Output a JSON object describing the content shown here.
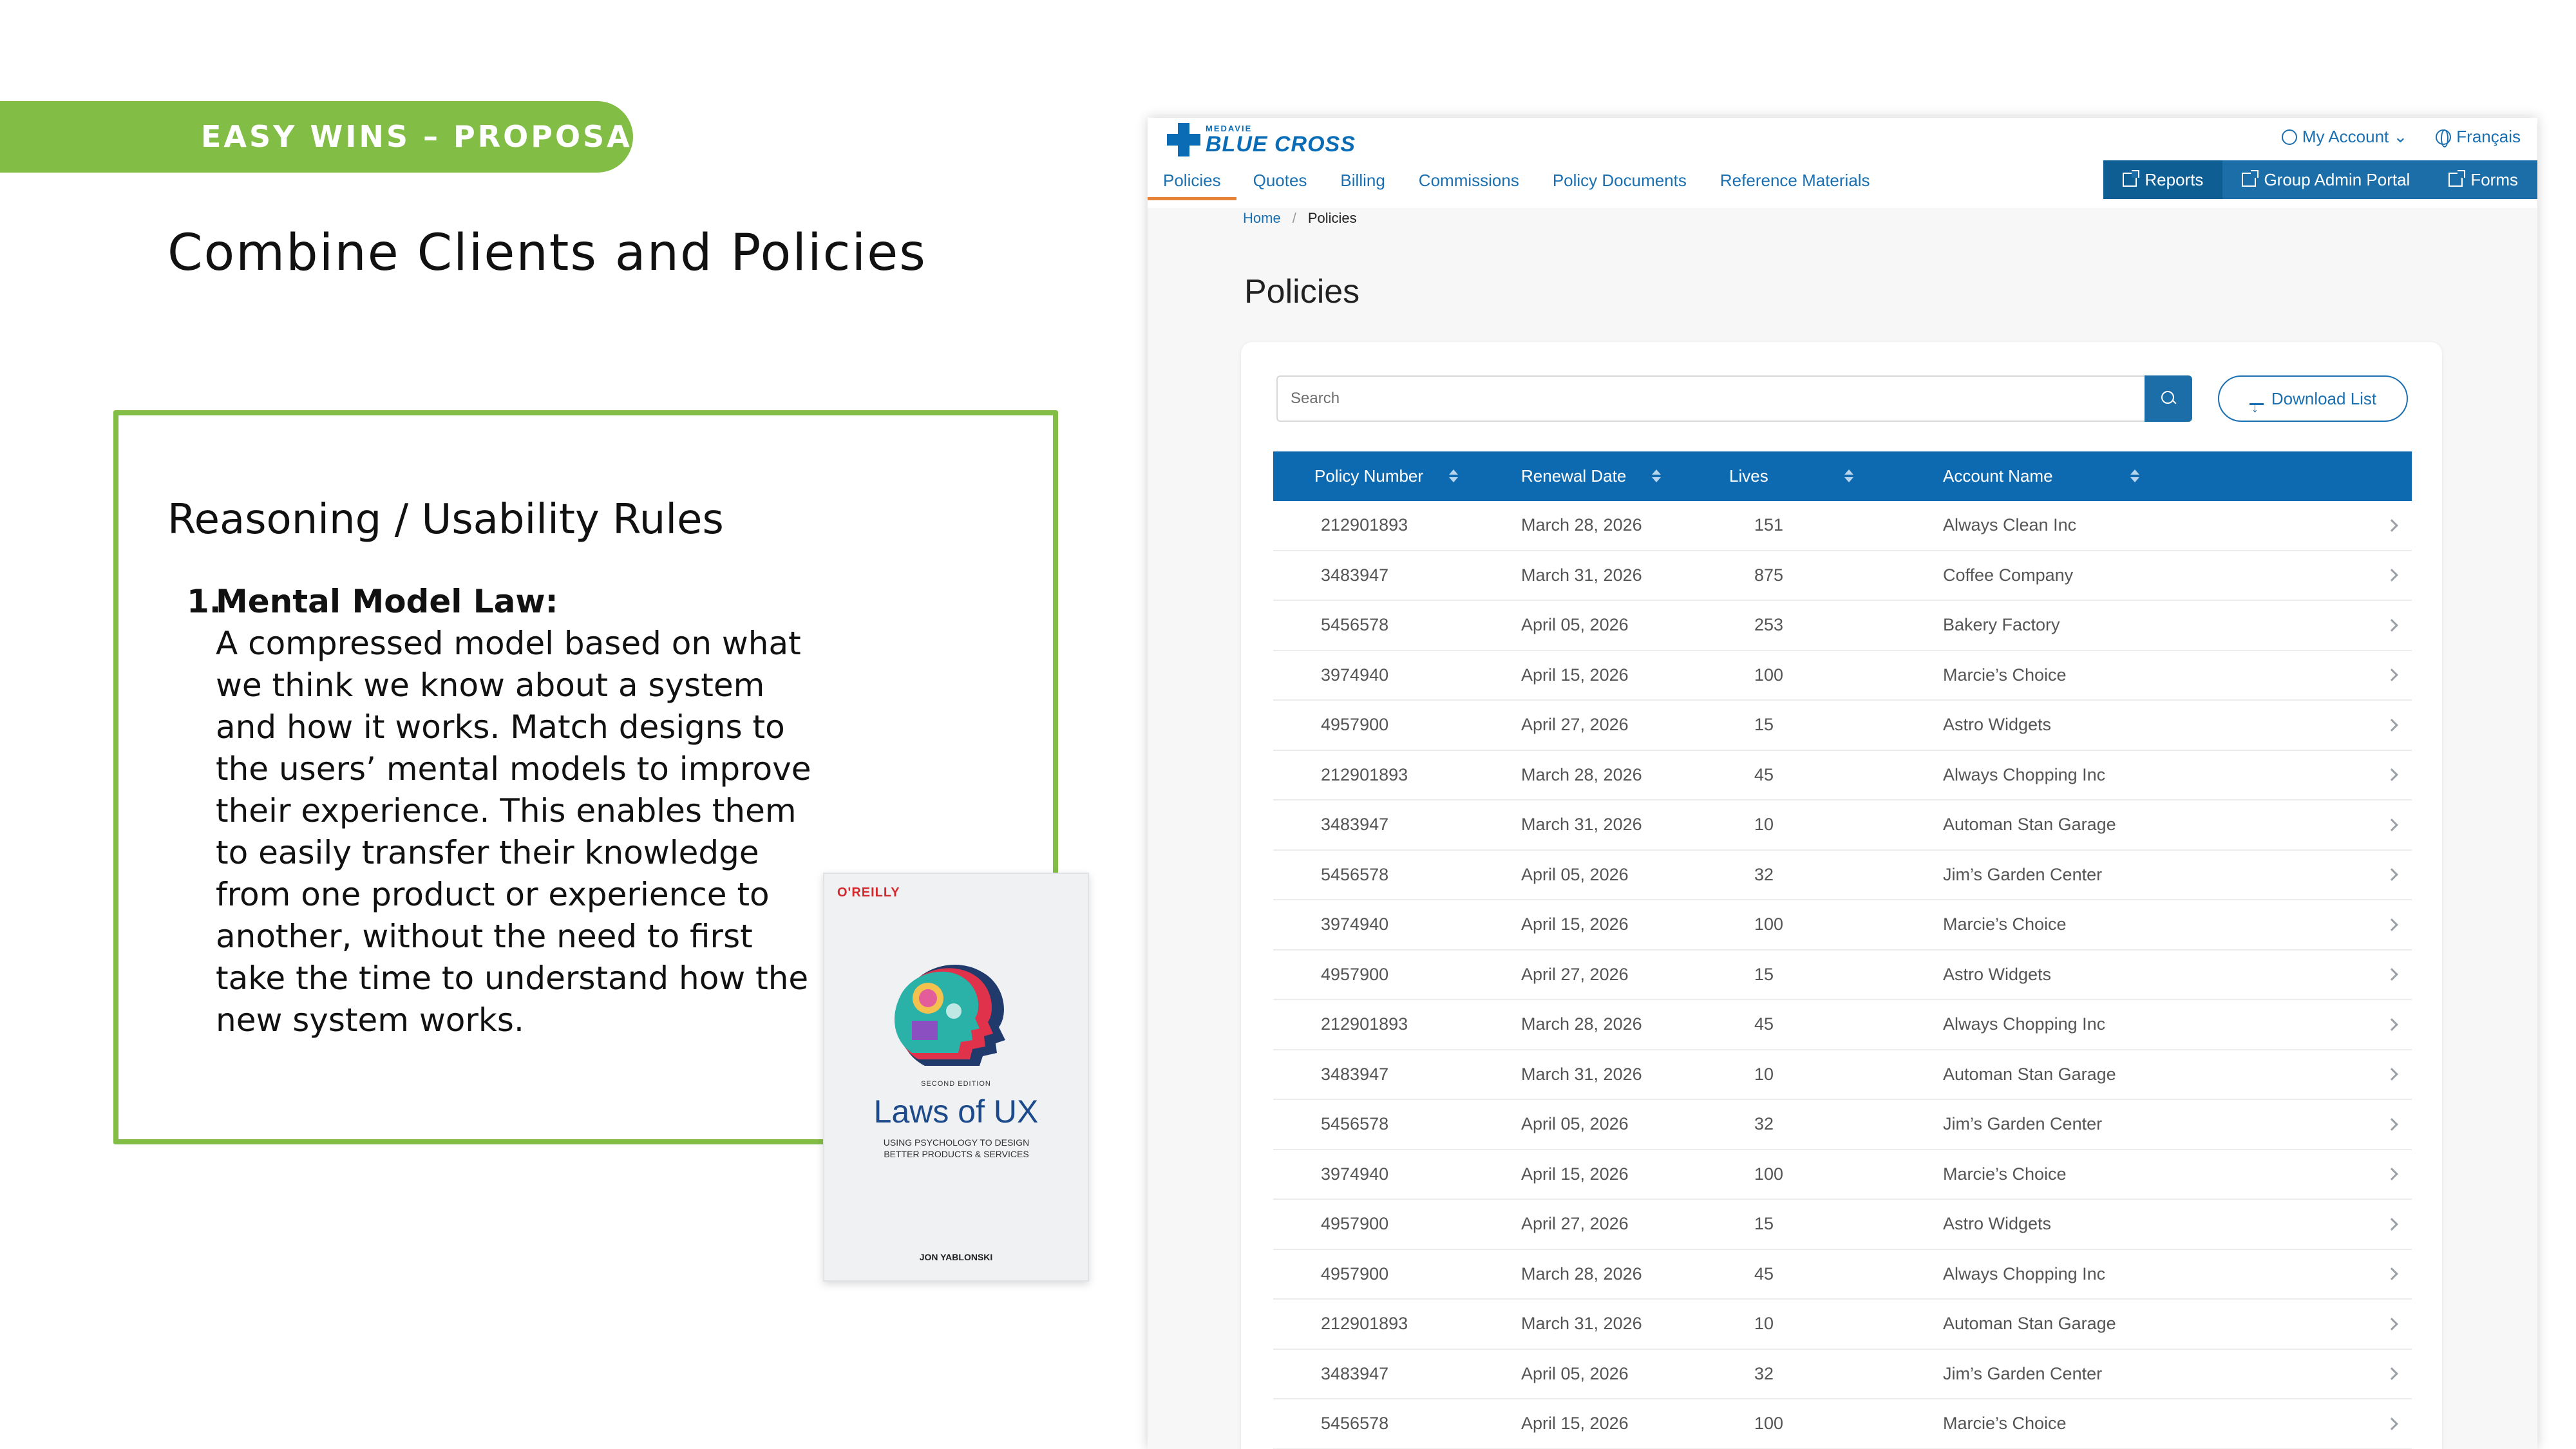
{
  "slide": {
    "tag": "EASY WINS – PROPOSAL",
    "title": "Combine Clients and Policies",
    "reasoning_title": "Reasoning / Usability Rules",
    "rule_number": "1.",
    "rule_label": "Mental Model Law:",
    "rule_text": "A compressed model based on what we think we know about a system and how it works. Match designs to the users’ mental models to improve their experience. This enables them to easily transfer their knowledge from one product or experience to another, without the need to first take the time to understand how the new system works."
  },
  "book": {
    "publisher": "O'REILLY",
    "edition": "SECOND EDITION",
    "title": "Laws of UX",
    "subtitle": "USING PSYCHOLOGY TO DESIGN BETTER PRODUCTS & SERVICES",
    "author": "JON YABLONSKI"
  },
  "app": {
    "logo_small": "MEDAVIE",
    "logo_big": "BLUE CROSS",
    "top_links": {
      "account": "My Account ⌄",
      "language": "Français"
    },
    "nav_tabs": [
      "Policies",
      "Quotes",
      "Billing",
      "Commissions",
      "Policy Documents",
      "Reference Materials"
    ],
    "ext_links": [
      "Reports",
      "Group Admin Portal",
      "Forms"
    ],
    "breadcrumb": {
      "home": "Home",
      "sep": "/",
      "current": "Policies"
    },
    "page_title": "Policies",
    "search_placeholder": "Search",
    "download_label": "Download List",
    "columns": [
      "Policy Number",
      "Renewal Date",
      "Lives",
      "Account Name"
    ],
    "rows": [
      [
        "212901893",
        "March 28, 2026",
        "151",
        "Always Clean Inc"
      ],
      [
        "3483947",
        "March 31, 2026",
        "875",
        "Coffee Company"
      ],
      [
        "5456578",
        "April 05, 2026",
        "253",
        "Bakery Factory"
      ],
      [
        "3974940",
        "April 15, 2026",
        "100",
        "Marcie’s Choice"
      ],
      [
        "4957900",
        "April 27, 2026",
        "15",
        "Astro Widgets"
      ],
      [
        "212901893",
        "March 28, 2026",
        "45",
        "Always Chopping Inc"
      ],
      [
        "3483947",
        "March 31, 2026",
        "10",
        "Automan Stan Garage"
      ],
      [
        "5456578",
        "April 05, 2026",
        "32",
        "Jim’s Garden Center"
      ],
      [
        "3974940",
        "April 15, 2026",
        "100",
        "Marcie’s Choice"
      ],
      [
        "4957900",
        "April 27, 2026",
        "15",
        "Astro Widgets"
      ],
      [
        "212901893",
        "March 28, 2026",
        "45",
        "Always Chopping Inc"
      ],
      [
        "3483947",
        "March 31, 2026",
        "10",
        "Automan Stan Garage"
      ],
      [
        "5456578",
        "April 05, 2026",
        "32",
        "Jim’s Garden Center"
      ],
      [
        "3974940",
        "April 15, 2026",
        "100",
        "Marcie’s Choice"
      ],
      [
        "4957900",
        "April 27, 2026",
        "15",
        "Astro Widgets"
      ],
      [
        "4957900",
        "March 28, 2026",
        "45",
        "Always Chopping Inc"
      ],
      [
        "212901893",
        "March 31, 2026",
        "10",
        "Automan Stan Garage"
      ],
      [
        "3483947",
        "April 05, 2026",
        "32",
        "Jim’s Garden Center"
      ],
      [
        "5456578",
        "April 15, 2026",
        "100",
        "Marcie’s Choice"
      ]
    ]
  },
  "colors": {
    "accent_green": "#82bd46",
    "brand_blue": "#0e6ab0",
    "active_tab": "#e8833a"
  }
}
